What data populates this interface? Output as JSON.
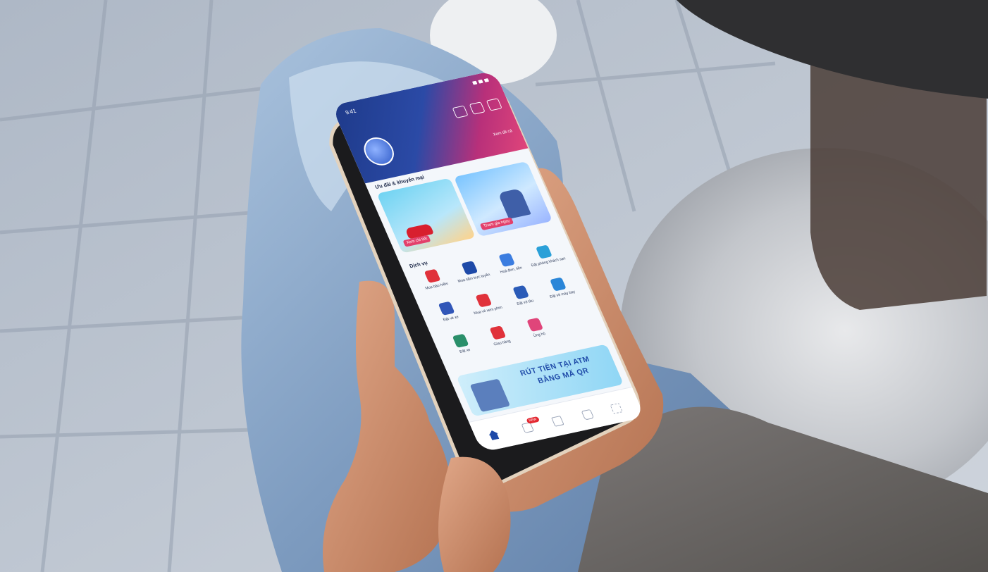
{
  "scene": {
    "description_icons": [
      "phone",
      "hand",
      "jeans",
      "table"
    ],
    "colors": {
      "floor": "#b9c2ce",
      "jeans": "#7f9dc0",
      "sweater": "#6b6867",
      "skin": "#c9896a",
      "table_top": "#3a3a3c",
      "table_base": "#b4b6ba",
      "phone_frame": "#e6d6c4"
    }
  },
  "app": {
    "status_time": "9:41",
    "header_link": "Xem tất cả",
    "promo_section_title": "Ưu đãi & khuyến mại",
    "promo_left_tag": "Xem chi tiết",
    "promo_right_tag": "Tham gia ngay",
    "services_title": "Dịch vụ",
    "services": [
      {
        "label": "Mua bảo hiểm",
        "icon": "shield-icon",
        "color": "#e0323b"
      },
      {
        "label": "Mua sắm trực tuyến",
        "icon": "cart-icon",
        "color": "#1e4aa8"
      },
      {
        "label": "Hoá đơn, tiền",
        "icon": "bill-icon",
        "color": "#3b7de0"
      },
      {
        "label": "Đặt phòng khách sạn",
        "icon": "hotel-icon",
        "color": "#2aa0d8"
      },
      {
        "label": "Đặt vé xe",
        "icon": "bus-icon",
        "color": "#3156b8"
      },
      {
        "label": "Mua vé xem phim",
        "icon": "ticket-icon",
        "color": "#e0323b"
      },
      {
        "label": "Đặt vé tàu",
        "icon": "train-icon",
        "color": "#2a5bb8"
      },
      {
        "label": "Đặt vé máy bay",
        "icon": "plane-icon",
        "color": "#2a86d8"
      },
      {
        "label": "Đặt xe",
        "icon": "car-icon",
        "color": "#2a8f6a"
      },
      {
        "label": "Giao hàng",
        "icon": "truck-icon",
        "color": "#e0323b"
      },
      {
        "label": "Ủng hộ",
        "icon": "heart-icon",
        "color": "#e0457a"
      }
    ],
    "banner_line1": "RÚT TIỀN TẠI ATM",
    "banner_line2": "BẰNG MÃ QR",
    "tab_badge": "NEW"
  }
}
